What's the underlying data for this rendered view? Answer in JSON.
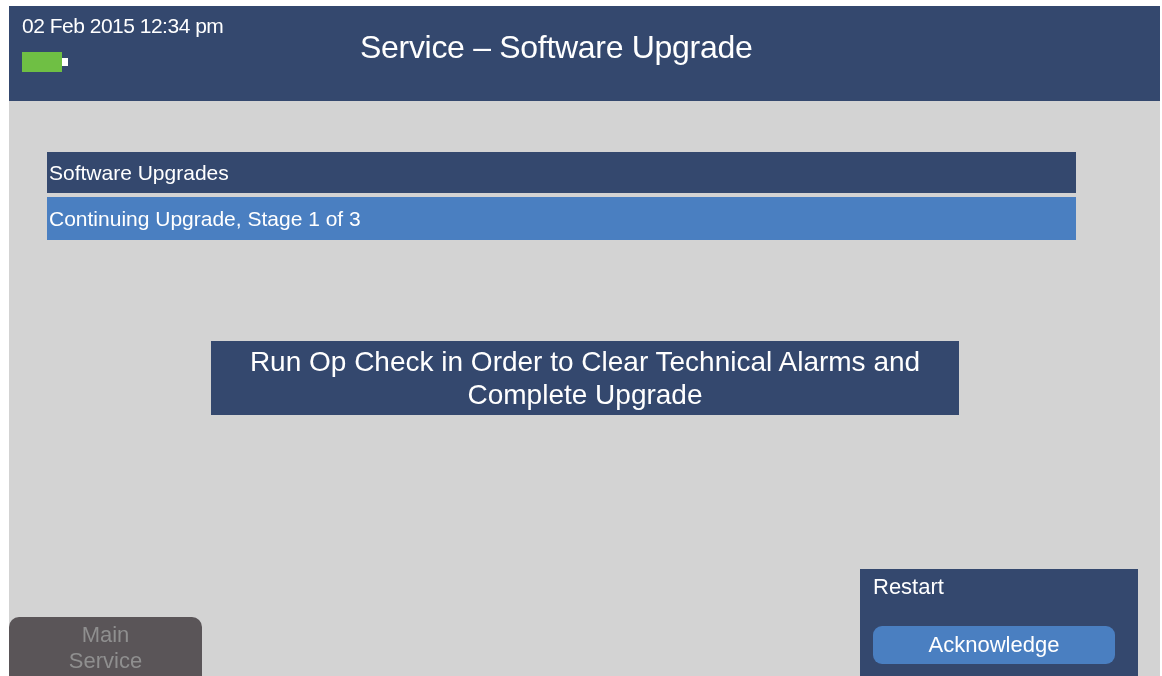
{
  "header": {
    "datetime": "02 Feb 2015 12:34 pm",
    "title": "Service – Software Upgrade"
  },
  "list": {
    "heading": "Software Upgrades",
    "items": [
      {
        "label": "Continuing Upgrade, Stage 1 of 3",
        "selected": true
      }
    ]
  },
  "message": "Run Op Check in Order to Clear Technical Alarms and Complete Upgrade",
  "nav_button": {
    "label": "Main Service",
    "disabled": true
  },
  "restart_panel": {
    "title": "Restart",
    "button": "Acknowledge"
  }
}
